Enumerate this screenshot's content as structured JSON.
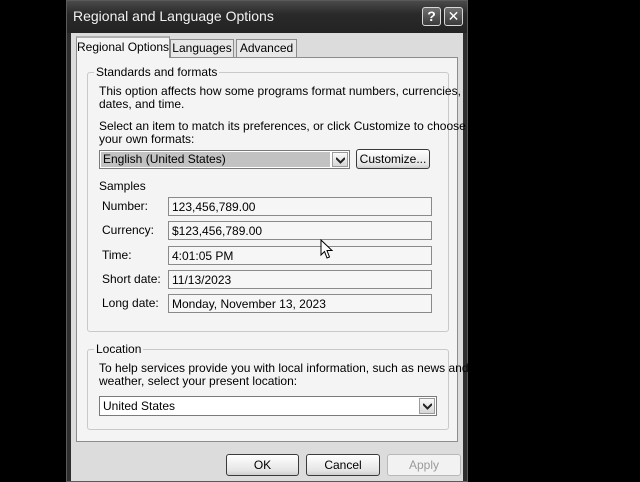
{
  "window": {
    "title": "Regional and Language Options",
    "help_glyph": "?",
    "close_glyph": "✕"
  },
  "tabs": [
    {
      "label": "Regional Options",
      "active": true
    },
    {
      "label": "Languages",
      "active": false
    },
    {
      "label": "Advanced",
      "active": false
    }
  ],
  "standards": {
    "group_title": "Standards and formats",
    "description_line1": "This option affects how some programs format numbers, currencies,",
    "description_line2": "dates, and time.",
    "select_line1": "Select an item to match its preferences, or click Customize to choose",
    "select_line2": "your own formats:",
    "format_value": "English (United States)",
    "customize_label": "Customize...",
    "samples_title": "Samples",
    "samples": [
      {
        "label": "Number:",
        "value": "123,456,789.00"
      },
      {
        "label": "Currency:",
        "value": "$123,456,789.00"
      },
      {
        "label": "Time:",
        "value": "4:01:05 PM"
      },
      {
        "label": "Short date:",
        "value": "11/13/2023"
      },
      {
        "label": "Long date:",
        "value": "Monday, November 13, 2023"
      }
    ]
  },
  "location": {
    "group_title": "Location",
    "description_line1": "To help services provide you with local information, such as news and",
    "description_line2": "weather, select your present location:",
    "value": "United States"
  },
  "buttons": {
    "ok": "OK",
    "cancel": "Cancel",
    "apply": "Apply"
  },
  "colors": {
    "desktop": "#000000",
    "titlebar": "#2e2e2e",
    "dialog_face": "#f4f4f4",
    "selection": "#c2c2c2"
  }
}
